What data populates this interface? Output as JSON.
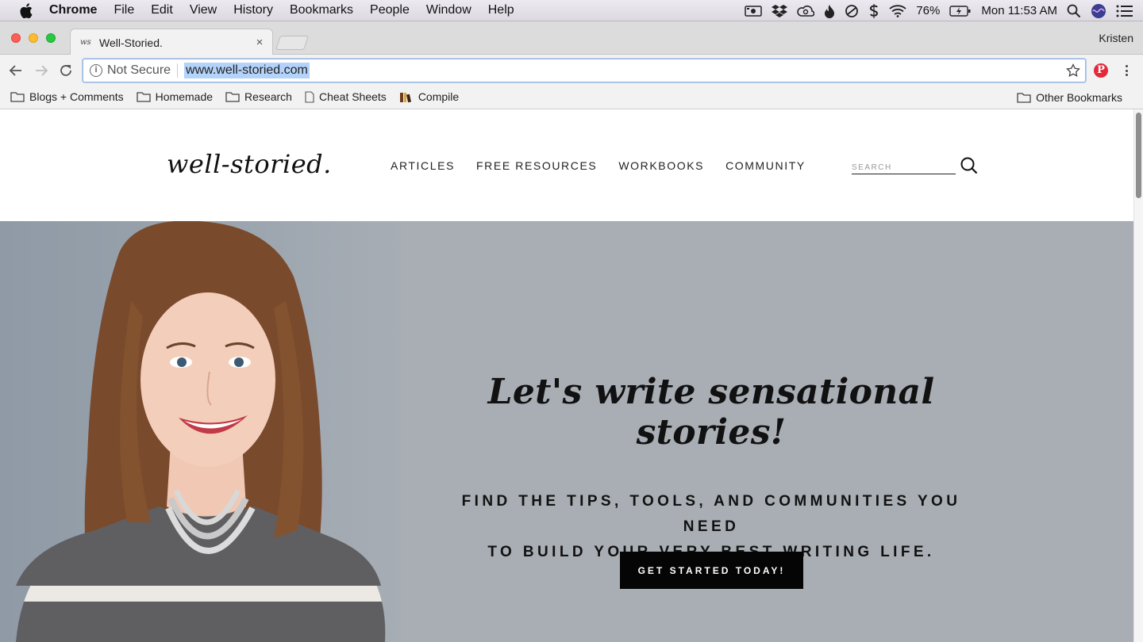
{
  "menubar": {
    "app_name": "Chrome",
    "items": [
      "File",
      "Edit",
      "View",
      "History",
      "Bookmarks",
      "People",
      "Window",
      "Help"
    ],
    "battery": "76%",
    "clock": "Mon 11:53 AM"
  },
  "browser": {
    "tab_title": "Well-Storied.",
    "tab_favicon": "ws",
    "tab_close": "×",
    "profile_name": "Kristen",
    "security_label": "Not Secure",
    "info_glyph": "i",
    "url": "www.well-storied.com",
    "pinterest_glyph": "P"
  },
  "bookmarks": {
    "items": [
      "Blogs + Comments",
      "Homemade",
      "Research",
      "Cheat Sheets",
      "Compile"
    ],
    "other": "Other Bookmarks"
  },
  "site": {
    "logo": "well-storied.",
    "nav": [
      "ARTICLES",
      "FREE RESOURCES",
      "WORKBOOKS",
      "COMMUNITY"
    ],
    "search_placeholder": "SEARCH",
    "hero_title": "Let's write sensational stories!",
    "hero_subtitle_line1": "FIND THE TIPS, TOOLS, AND COMMUNITIES YOU NEED",
    "hero_subtitle_line2": "TO BUILD YOUR VERY BEST WRITING LIFE.",
    "cta_label": "GET STARTED TODAY!"
  },
  "colors": {
    "hero_bg": "#a9aeb5",
    "cta_bg": "#050505",
    "url_highlight": "#b4d3fb"
  }
}
